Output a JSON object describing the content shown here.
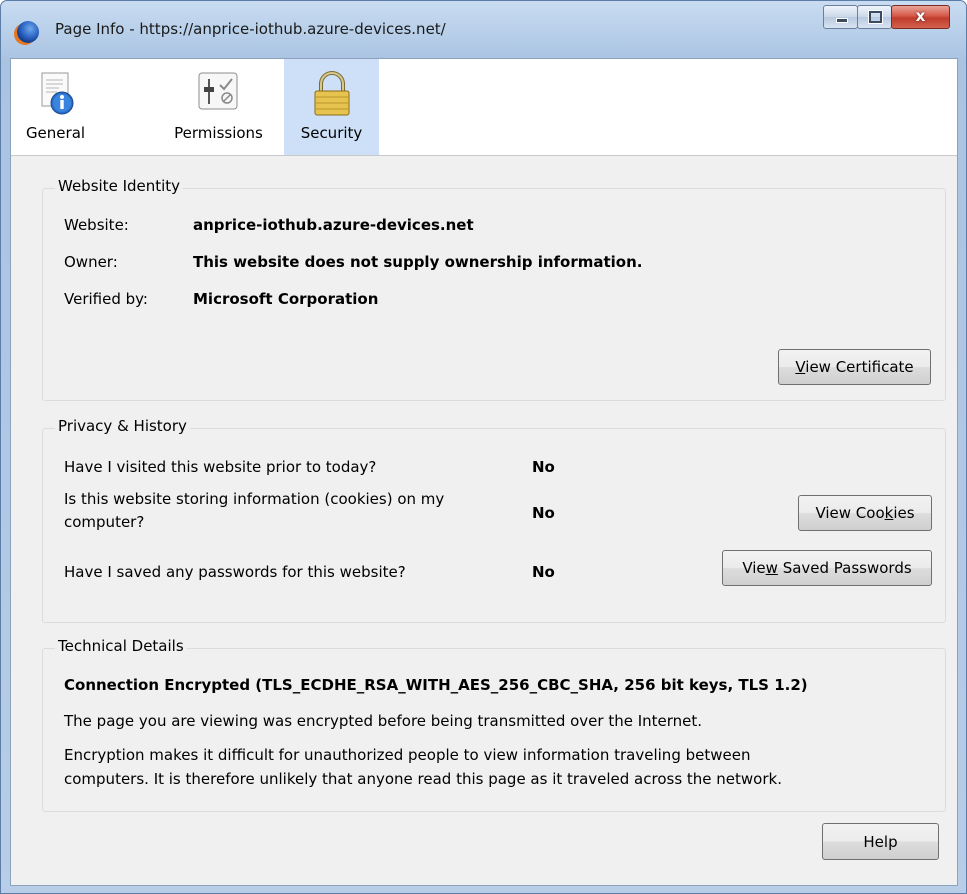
{
  "window": {
    "title": "Page Info - https://anprice-iothub.azure-devices.net/",
    "close_symbol": "x"
  },
  "toolbar": {
    "tabs": [
      {
        "label": "General",
        "icon": "info-document-icon",
        "selected": false
      },
      {
        "label": "Permissions",
        "icon": "permissions-sliders-icon",
        "selected": false
      },
      {
        "label": "Security",
        "icon": "padlock-icon",
        "selected": true
      }
    ]
  },
  "identity": {
    "legend": "Website Identity",
    "website_label": "Website:",
    "website_value": "anprice-iothub.azure-devices.net",
    "owner_label": "Owner:",
    "owner_value": "This website does not supply ownership information.",
    "verified_label": "Verified by:",
    "verified_value": "Microsoft Corporation",
    "view_certificate": {
      "mnemonic": "V",
      "rest": "iew Certificate"
    }
  },
  "privacy": {
    "legend": "Privacy & History",
    "q_visited": "Have I visited this website prior to today?",
    "a_visited": "No",
    "q_cookies_line1": "Is this website storing information (cookies) on my",
    "q_cookies_line2": "computer?",
    "a_cookies": "No",
    "q_passwords": "Have I saved any passwords for this website?",
    "a_passwords": "No",
    "view_cookies": {
      "pre": "View Coo",
      "mnemonic": "k",
      "post": "ies"
    },
    "view_passwords": {
      "pre": "Vie",
      "mnemonic": "w",
      "post": " Saved Passwords"
    }
  },
  "technical": {
    "legend": "Technical Details",
    "headline": "Connection Encrypted (TLS_ECDHE_RSA_WITH_AES_256_CBC_SHA, 256 bit keys, TLS 1.2)",
    "line1": "The page you are viewing was encrypted before being transmitted over the Internet.",
    "line2": "Encryption makes it difficult for unauthorized people to view information traveling between",
    "line3": "computers. It is therefore unlikely that anyone read this page as it traveled across the network."
  },
  "footer": {
    "help_label": "Help"
  }
}
